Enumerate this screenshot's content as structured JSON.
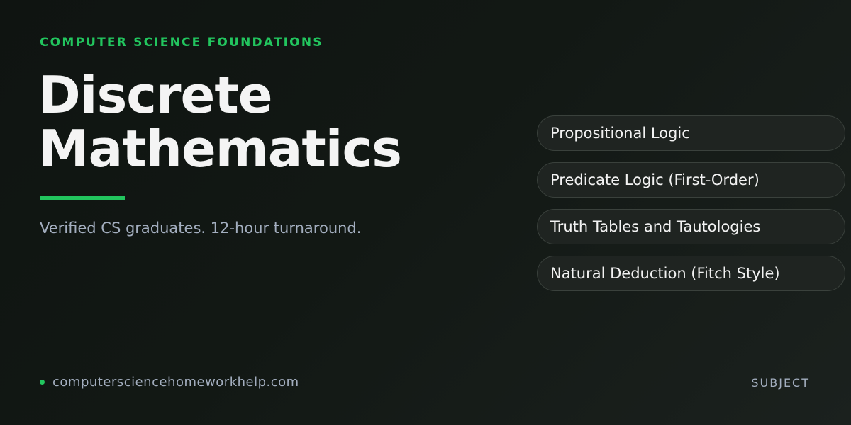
{
  "eyebrow": "COMPUTER SCIENCE FOUNDATIONS",
  "title": {
    "line1": "Discrete",
    "line2": "Mathematics"
  },
  "tagline": "Verified CS graduates. 12-hour turnaround.",
  "topics": [
    {
      "label": "Propositional Logic"
    },
    {
      "label": "Predicate Logic (First-Order)"
    },
    {
      "label": "Truth Tables and Tautologies"
    },
    {
      "label": "Natural Deduction (Fitch Style)"
    }
  ],
  "footer": {
    "site": "computersciencehomeworkhelp.com",
    "label": "SUBJECT"
  },
  "colors": {
    "accent": "#22c55e",
    "background": "#121814",
    "muted_text": "#a3aebf"
  },
  "icons": {
    "footer_bullet": "dot-icon"
  }
}
